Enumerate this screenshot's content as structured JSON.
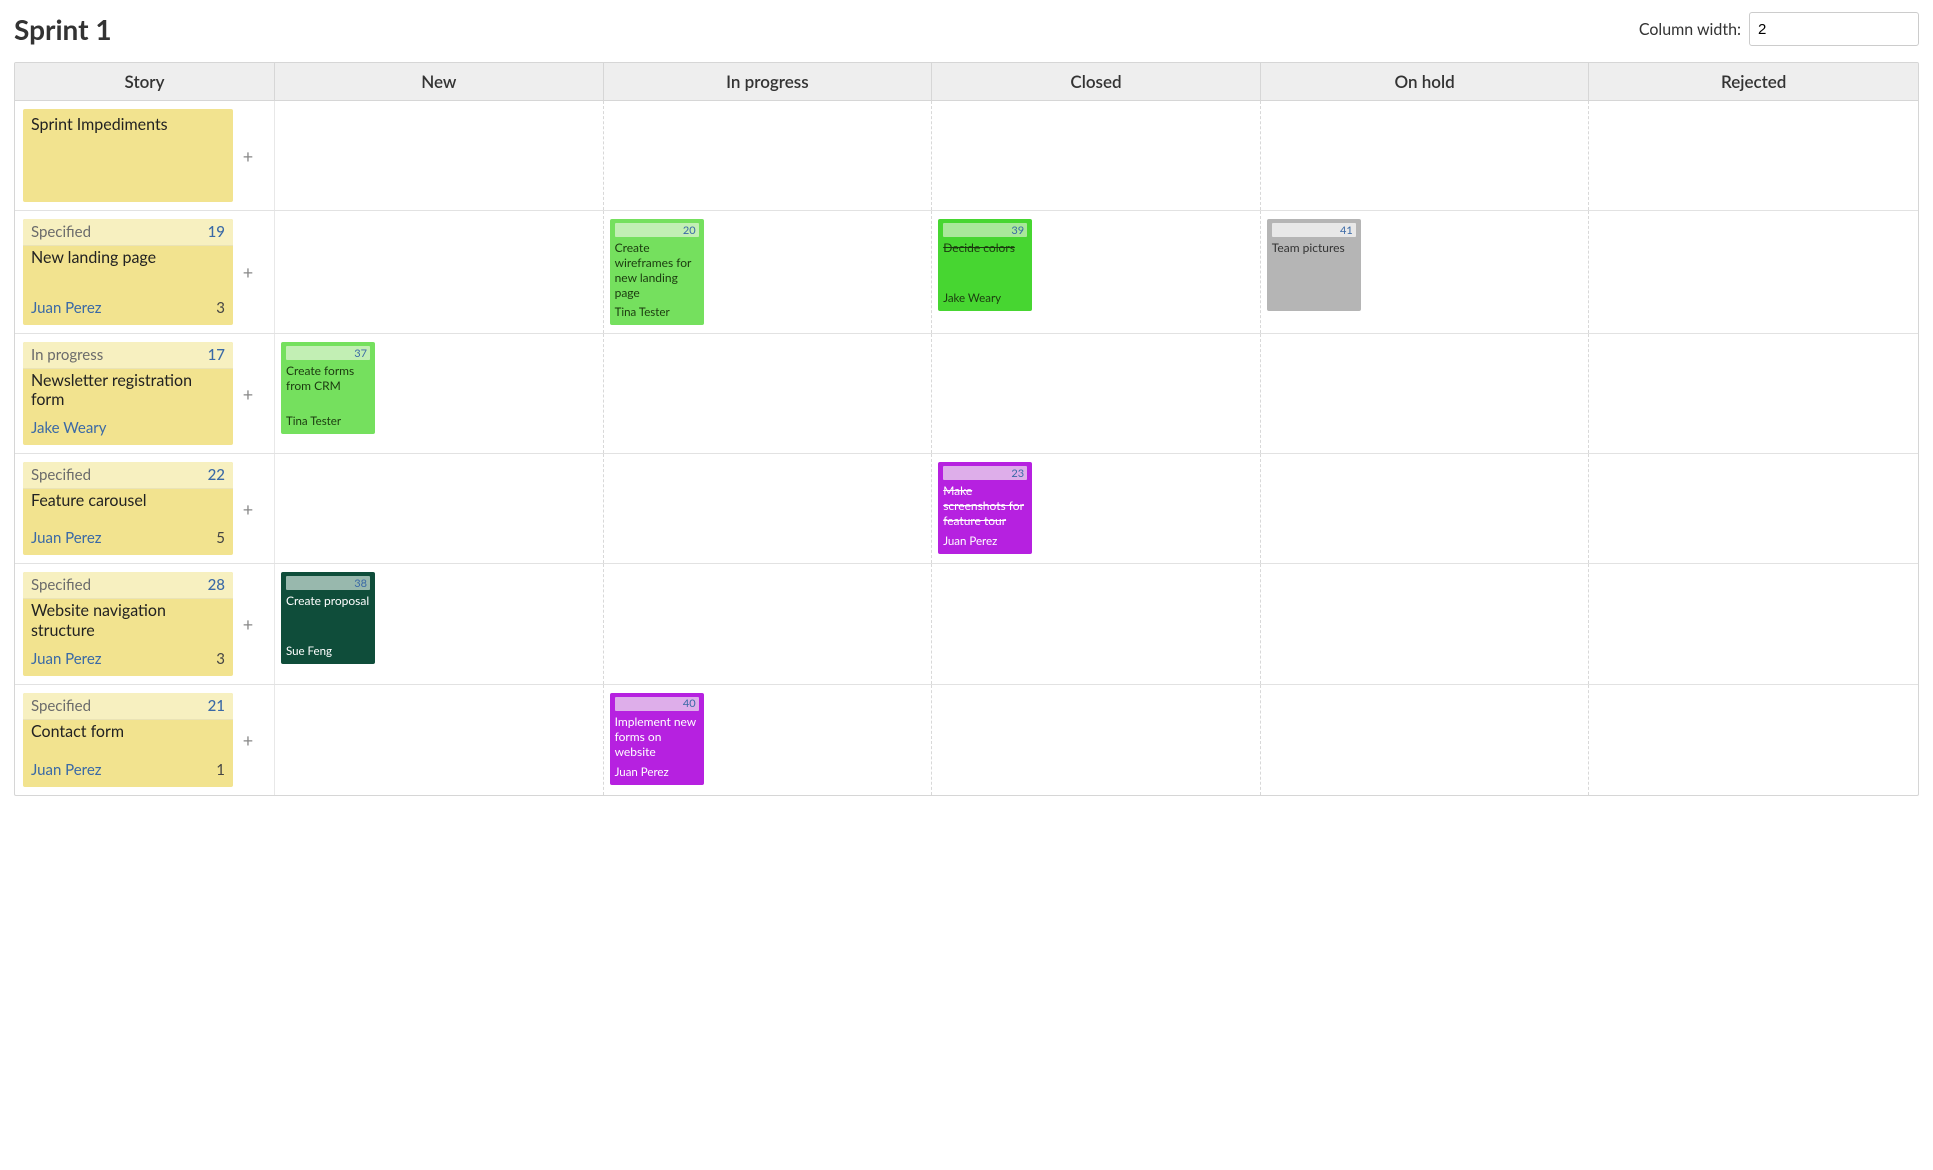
{
  "page_title": "Sprint 1",
  "column_width_label": "Column width:",
  "column_width_value": "2",
  "columns": {
    "story": "Story",
    "new": "New",
    "in_progress": "In progress",
    "closed": "Closed",
    "on_hold": "On hold",
    "rejected": "Rejected"
  },
  "add_label": "+",
  "rows": [
    {
      "story": {
        "status": "",
        "id": "",
        "title": "Sprint Impediments",
        "owner": "",
        "points": ""
      },
      "new": [],
      "in_progress": [],
      "closed": [],
      "on_hold": [],
      "rejected": []
    },
    {
      "story": {
        "status": "Specified",
        "id": "19",
        "title": "New landing page",
        "owner": "Juan Perez",
        "points": "3"
      },
      "new": [],
      "in_progress": [
        {
          "id": "20",
          "title": "Create wireframes for new landing page",
          "owner": "Tina Tester",
          "color": "lgreen",
          "strike": false
        }
      ],
      "closed": [
        {
          "id": "39",
          "title": "Decide colors",
          "owner": "Jake Weary",
          "color": "green",
          "strike": true
        }
      ],
      "on_hold": [
        {
          "id": "41",
          "title": "Team pictures",
          "owner": "",
          "color": "grey",
          "strike": false
        }
      ],
      "rejected": []
    },
    {
      "story": {
        "status": "In progress",
        "id": "17",
        "title": "Newsletter registration form",
        "owner": "Jake Weary",
        "points": ""
      },
      "new": [
        {
          "id": "37",
          "title": "Create forms from CRM",
          "owner": "Tina Tester",
          "color": "lgreen",
          "strike": false
        }
      ],
      "in_progress": [],
      "closed": [],
      "on_hold": [],
      "rejected": []
    },
    {
      "story": {
        "status": "Specified",
        "id": "22",
        "title": "Feature carousel",
        "owner": "Juan Perez",
        "points": "5"
      },
      "new": [],
      "in_progress": [],
      "closed": [
        {
          "id": "23",
          "title": "Make screenshots for feature tour",
          "owner": "Juan Perez",
          "color": "purple",
          "strike": true
        }
      ],
      "on_hold": [],
      "rejected": []
    },
    {
      "story": {
        "status": "Specified",
        "id": "28",
        "title": "Website navigation structure",
        "owner": "Juan Perez",
        "points": "3"
      },
      "new": [
        {
          "id": "38",
          "title": "Create proposal",
          "owner": "Sue Feng",
          "color": "dgreen",
          "strike": false
        }
      ],
      "in_progress": [],
      "closed": [],
      "on_hold": [],
      "rejected": []
    },
    {
      "story": {
        "status": "Specified",
        "id": "21",
        "title": "Contact form",
        "owner": "Juan Perez",
        "points": "1"
      },
      "new": [],
      "in_progress": [
        {
          "id": "40",
          "title": "Implement new forms on website",
          "owner": "Juan Perez",
          "color": "purple",
          "strike": false
        }
      ],
      "closed": [],
      "on_hold": [],
      "rejected": []
    }
  ]
}
